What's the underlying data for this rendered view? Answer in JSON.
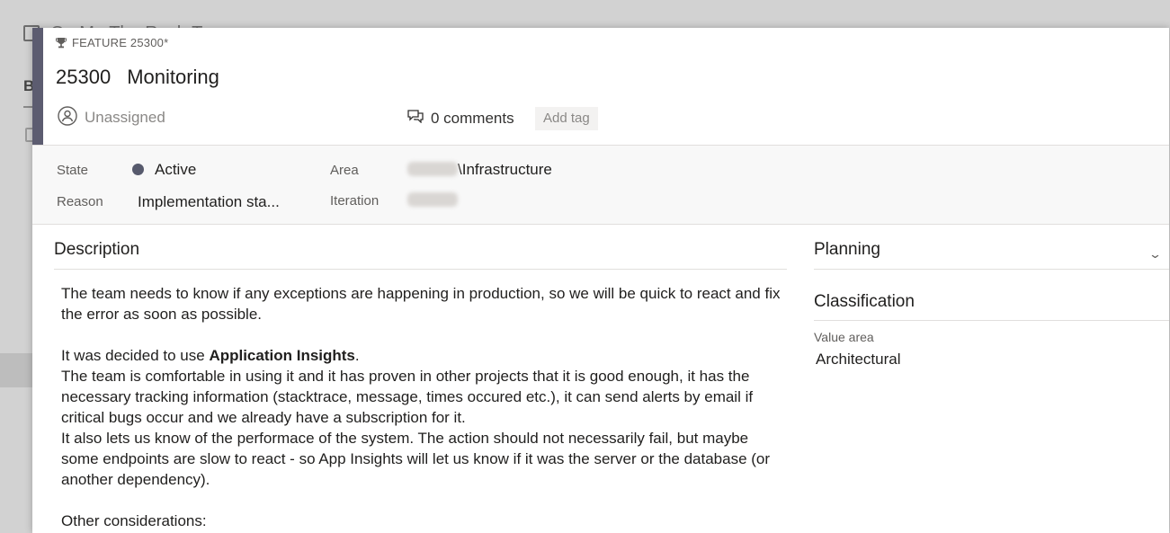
{
  "background": {
    "project_title": "Go Mo The Rush To",
    "tab_letter": "B"
  },
  "header": {
    "item_type": "FEATURE 25300*",
    "id": "25300",
    "title": "Monitoring",
    "assigned_to": "Unassigned",
    "comments": "0 comments",
    "add_tag": "Add tag"
  },
  "fields": {
    "state_label": "State",
    "state_value": "Active",
    "reason_label": "Reason",
    "reason_value": "Implementation sta...",
    "area_label": "Area",
    "area_value": "\\Infrastructure",
    "iteration_label": "Iteration"
  },
  "description": {
    "heading": "Description",
    "paragraphs": [
      "The team needs to know if any exceptions are happening in production, so we will be quick to react and fix the error as soon as possible.",
      "It was decided to use ",
      "Application Insights",
      ".",
      "The team is comfortable in using it and it has proven in other projects that it is good enough, it has the necessary tracking information (stacktrace, message, times occured etc.), it can send alerts by email if critical bugs occur and we already have a subscription for it.",
      "It also lets us know of the performace of the system. The action should not necessarily fail, but maybe some endpoints are slow to react - so App Insights will let us know if it was the server or the database (or another dependency).",
      "Other considerations:"
    ]
  },
  "planning": {
    "heading": "Planning"
  },
  "classification": {
    "heading": "Classification",
    "value_area_label": "Value area",
    "value_area_value": "Architectural"
  },
  "colors": {
    "accent": "#5c5c70",
    "state_dot": "#575a6d"
  }
}
